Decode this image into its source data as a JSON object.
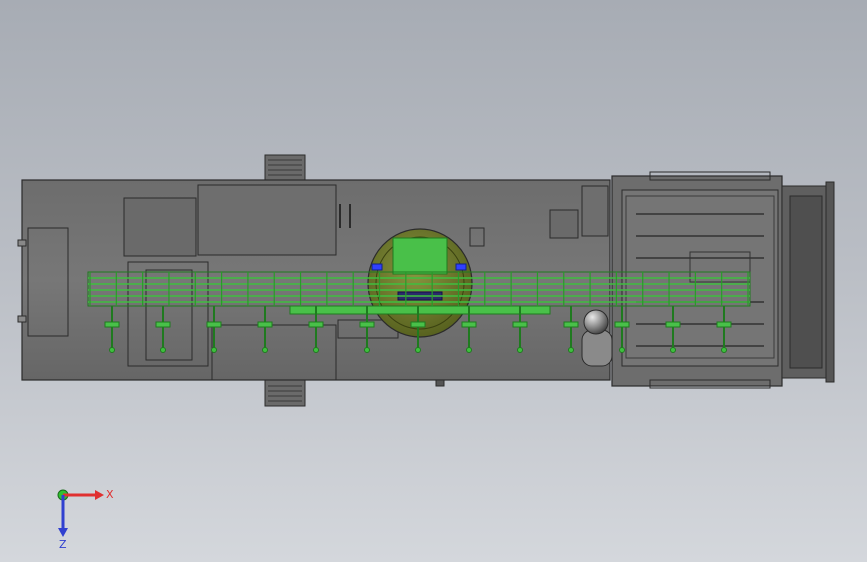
{
  "viewport": {
    "background_top": "#a7acb4",
    "background_bottom": "#d4d7dc"
  },
  "model": {
    "colors": {
      "body": "#707070",
      "body_dark": "#4a4a4a",
      "body_light": "#8a8a8a",
      "edge": "#2b2b2b",
      "rail": "#3fbf3f",
      "rail_dark": "#1f7a1f",
      "turret": "#6e7a2e",
      "turret_box": "#49c049",
      "accent_blue": "#3040ff"
    },
    "nozzle_count": 13,
    "rail_post_count": 26
  },
  "triad": {
    "x_label": "X",
    "z_label": "Z",
    "x_color": "#e03030",
    "y_color": "#30c030",
    "z_color": "#3040d0"
  }
}
